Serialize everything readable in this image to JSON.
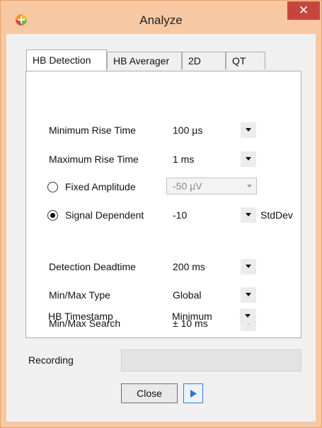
{
  "window": {
    "title": "Analyze",
    "close_glyph": "✕",
    "app_icon": "colorful-app-icon",
    "accent_border": "#ec9f65",
    "titlebar_color": "#f7c8a4",
    "close_color": "#c7463b"
  },
  "tabs": [
    {
      "label": "HB Detection",
      "active": true
    },
    {
      "label": "HB Averager",
      "active": false
    },
    {
      "label": "2D",
      "active": false
    },
    {
      "label": "QT",
      "active": false
    }
  ],
  "settings": {
    "min_rise_time": {
      "label": "Minimum Rise Time",
      "value": "100 µs"
    },
    "max_rise_time": {
      "label": "Maximum Rise Time",
      "value": "1 ms"
    },
    "fixed_amplitude": {
      "label": "Fixed Amplitude",
      "value": "-50 µV",
      "selected": false,
      "enabled": false
    },
    "signal_dependent": {
      "label": "Signal Dependent",
      "value": "-10",
      "unit": "StdDev",
      "selected": true
    },
    "detection_deadtime": {
      "label": "Detection Deadtime",
      "value": "200 ms"
    },
    "minmax_type": {
      "label": "Min/Max Type",
      "value": "Global"
    },
    "minmax_search": {
      "label": "Min/Max Search",
      "value": "± 10 ms"
    },
    "hb_timestamp": {
      "label": "HB Timestamp",
      "value": "Minimum"
    }
  },
  "recording": {
    "label": "Recording",
    "value": ""
  },
  "buttons": {
    "close_label": "Close",
    "play_icon": "play-icon",
    "play_color": "#2f6fd0"
  }
}
